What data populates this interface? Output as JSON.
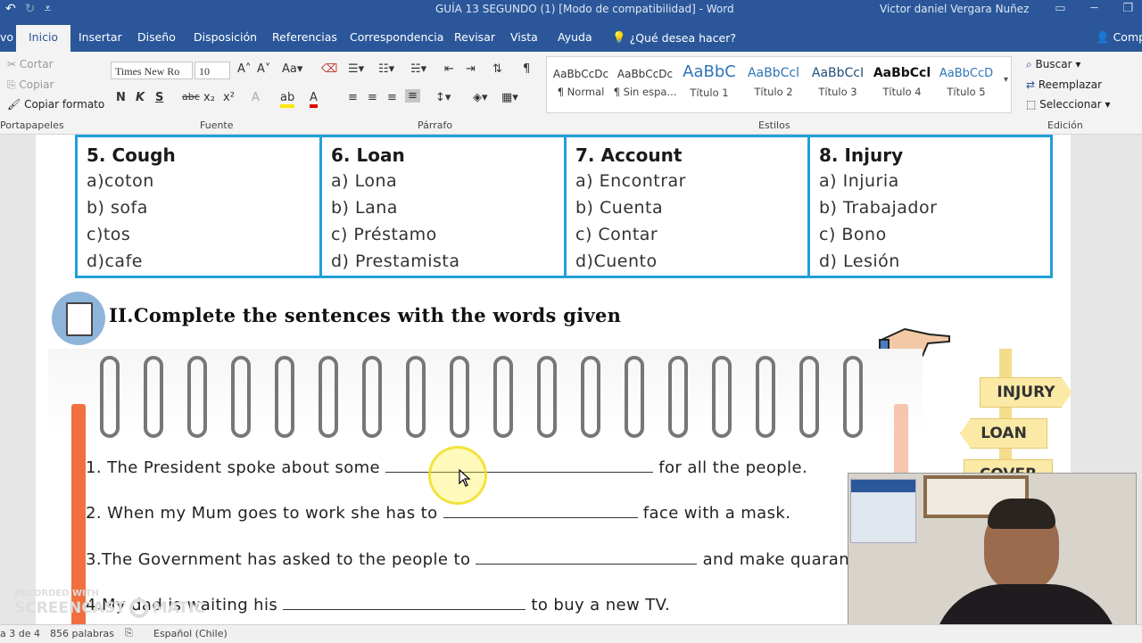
{
  "titlebar": {
    "doc_title": "GUÍA 13 SEGUNDO (1) [Modo de compatibilidad]  -  Word",
    "user": "Victor daniel Vergara Nuñez"
  },
  "tabs": {
    "file": "vo",
    "items": [
      "Inicio",
      "Insertar",
      "Diseño",
      "Disposición",
      "Referencias",
      "Correspondencia",
      "Revisar",
      "Vista",
      "Ayuda"
    ],
    "tell_me": "¿Qué desea hacer?",
    "share": "Comp"
  },
  "ribbon": {
    "clipboard": {
      "cut": "Cortar",
      "copy": "Copiar",
      "format_painter": "Copiar formato",
      "label": "Portapapeles"
    },
    "font": {
      "name": "Times New Ro",
      "size": "10",
      "label": "Fuente",
      "bold": "N",
      "italic": "K",
      "underline": "S",
      "strike": "abc",
      "sub": "x₂",
      "sup": "x²"
    },
    "paragraph": {
      "label": "Párrafo"
    },
    "styles": {
      "label": "Estilos",
      "items": [
        {
          "preview": "AaBbCcDc",
          "name": "¶ Normal"
        },
        {
          "preview": "AaBbCcDc",
          "name": "¶ Sin espa..."
        },
        {
          "preview": "AaBbC",
          "name": "Título 1"
        },
        {
          "preview": "AaBbCcl",
          "name": "Título 2"
        },
        {
          "preview": "AaBbCcI",
          "name": "Título 3"
        },
        {
          "preview": "AaBbCcl",
          "name": "Título 4"
        },
        {
          "preview": "AaBbCcD",
          "name": "Título 5"
        }
      ]
    },
    "editing": {
      "find": "Buscar",
      "replace": "Reemplazar",
      "select": "Seleccionar",
      "label": "Edición"
    }
  },
  "vocab": [
    {
      "head": "5. Cough",
      "options": [
        "a)coton",
        "b) sofa",
        "c)tos",
        "d)cafe"
      ]
    },
    {
      "head": "6. Loan",
      "options": [
        "a) Lona",
        "b) Lana",
        "c) Préstamo",
        "d) Prestamista"
      ]
    },
    {
      "head": "7. Account",
      "options": [
        "a) Encontrar",
        "b) Cuenta",
        "c) Contar",
        "d)Cuento"
      ]
    },
    {
      "head": "8. Injury",
      "options": [
        "a) Injuria",
        "b) Trabajador",
        "c) Bono",
        "d) Lesión"
      ]
    }
  ],
  "section": {
    "title": "II.Complete the sentences with the words given"
  },
  "sentences": [
    {
      "pre": "1.  The President spoke about some ",
      "post": " for all the people."
    },
    {
      "pre": "2. When my Mum goes to work she has to ",
      "post": " face with a mask."
    },
    {
      "pre": "3.The Government has asked to the people to ",
      "post": " and make quaran"
    },
    {
      "pre": "4.My dad is waiting his ",
      "post": " to buy a new TV."
    }
  ],
  "signs": [
    "INJURY",
    "LOAN",
    "COVER"
  ],
  "status": {
    "page": "a 3 de 4",
    "words": "856 palabras",
    "language": "Español (Chile)"
  },
  "watermark": {
    "line1": "RECORDED WITH",
    "line2": "SCREENCAST",
    "line3": "MATIC"
  }
}
